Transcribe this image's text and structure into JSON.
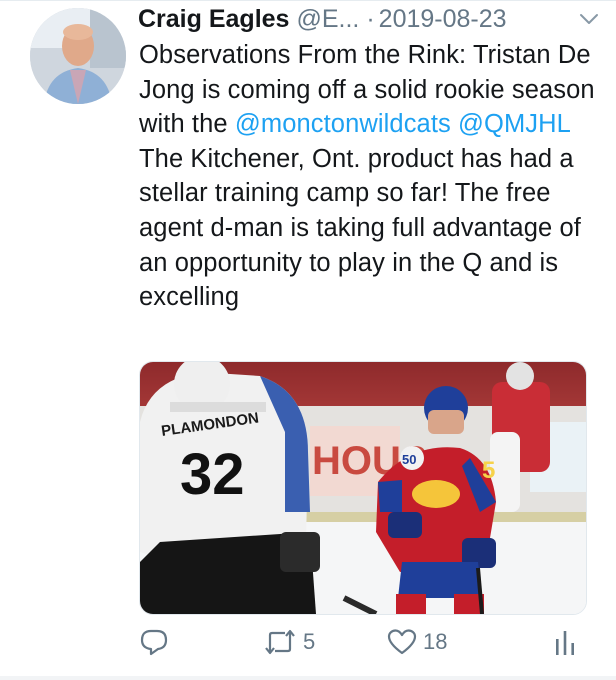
{
  "tweet": {
    "author_name": "Craig Eagles",
    "author_handle": "@E...",
    "separator": "·",
    "date": "2019-08-23",
    "text_part1": "Observations From the Rink: Tristan De Jong is coming off a solid rookie season with the ",
    "mention1": "@monctonwildcats",
    "space": " ",
    "mention2": "@QMJHL",
    "text_part2": " The Kitchener, Ont. product has had a stellar training camp so far! The free agent d-man is taking full advantage of an opportunity to play in the Q and is excelling"
  },
  "media": {
    "player_left_nameplate": "PLAMONDON",
    "player_left_number": "32",
    "player_right_number": "5",
    "player_right_patch": "50",
    "arena_sign": "HOUS"
  },
  "actions": {
    "reply_count": "",
    "retweet_count": "5",
    "like_count": "18"
  },
  "colors": {
    "accent": "#1da1f2",
    "secondary_text": "#657786"
  },
  "icons": {
    "caret": "chevron-down-icon",
    "reply": "reply-icon",
    "retweet": "retweet-icon",
    "like": "heart-icon",
    "analytics": "analytics-icon"
  }
}
